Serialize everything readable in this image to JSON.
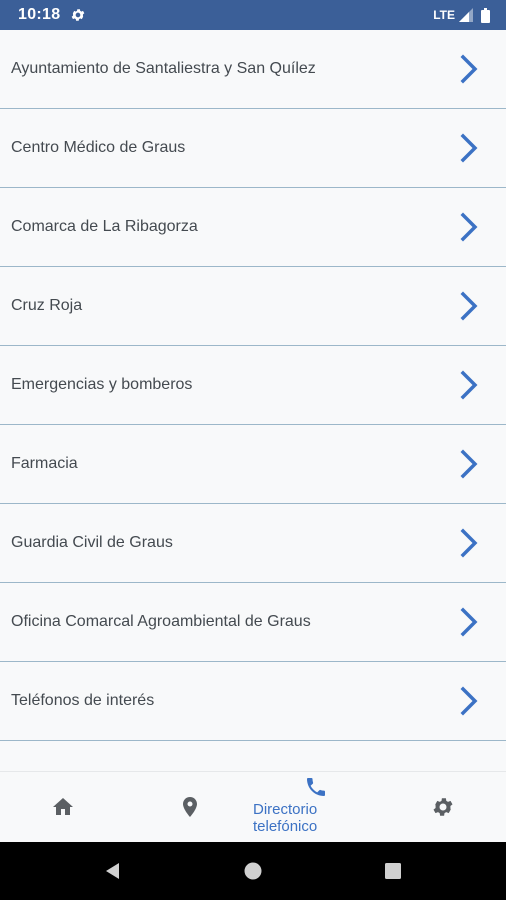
{
  "status_bar": {
    "time": "10:18",
    "network": "LTE"
  },
  "directory": {
    "items": [
      {
        "label": "Ayuntamiento de Santaliestra y San Quílez"
      },
      {
        "label": "Centro Médico de Graus"
      },
      {
        "label": "Comarca de La Ribagorza"
      },
      {
        "label": "Cruz Roja"
      },
      {
        "label": "Emergencias y bomberos"
      },
      {
        "label": "Farmacia"
      },
      {
        "label": "Guardia Civil de Graus"
      },
      {
        "label": "Oficina Comarcal Agroambiental de Graus"
      },
      {
        "label": "Teléfonos de interés"
      }
    ]
  },
  "bottom_nav": {
    "items": [
      {
        "icon": "home-icon"
      },
      {
        "icon": "location-pin-icon"
      },
      {
        "icon": "phone-icon",
        "label": "Directorio telefónico",
        "active": true
      },
      {
        "icon": "gear-icon"
      }
    ]
  },
  "colors": {
    "status_bar": "#3b5f98",
    "accent": "#3c72c4",
    "divider": "#9cb7c9",
    "text": "#444a50",
    "nav_icon": "#5b5f63"
  }
}
